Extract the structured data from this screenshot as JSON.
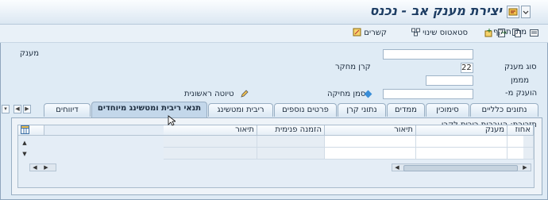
{
  "window": {
    "title": "יצירת מענק אב - נכנס"
  },
  "toolbar": {
    "items": [
      {
        "label": "מתן תוקף",
        "icon": "validate-icon"
      },
      {
        "label": "סטאטוס שינוי",
        "icon": "status-change-icon"
      },
      {
        "label": "קשרים",
        "icon": "relationships-icon"
      }
    ]
  },
  "form": {
    "grant_label": "מענק",
    "grant_value": "",
    "grant_type_label": "סוג מענק",
    "grant_type_value": "22",
    "grant_type_desc": "קרן מחקר",
    "funder_label": "מממן",
    "funder_value": "",
    "awarded_label": "הוענק מ-",
    "awarded_value": "",
    "deletion_flag_label": "סמן מחיקה",
    "draft_label": "טיוטה ראשונית"
  },
  "tabs": [
    {
      "label": "נתונים כלליים",
      "active": false
    },
    {
      "label": "סימוכין",
      "active": false
    },
    {
      "label": "ממדים",
      "active": false
    },
    {
      "label": "נתוני קרן",
      "active": false
    },
    {
      "label": "פרטים נוספים",
      "active": false
    },
    {
      "label": "ריבית ומטשינג",
      "active": false
    },
    {
      "label": "תנאי ריבית ומטשינג מיוחדים",
      "active": true
    },
    {
      "label": "דיווחים",
      "active": false
    }
  ],
  "panel": {
    "title": "תזכורת: העברות ריבית לקרן",
    "columns": [
      "אחוז",
      "מענק",
      "תיאור",
      "הזמנה פנימית",
      "תיאור"
    ]
  }
}
